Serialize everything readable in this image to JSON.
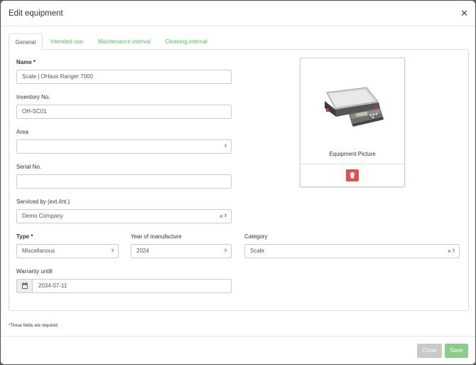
{
  "modal": {
    "title": "Edit equipment",
    "close_icon": "close-icon"
  },
  "tabs": [
    {
      "label": "General",
      "active": true
    },
    {
      "label": "Intended use",
      "active": false
    },
    {
      "label": "Maintenance interval",
      "active": false
    },
    {
      "label": "Cleaning interval",
      "active": false
    }
  ],
  "form": {
    "name": {
      "label": "Name",
      "required_mark": "*",
      "value": "Scale | OHaus Ranger 7000"
    },
    "inventory_no": {
      "label": "Inventory No.",
      "value": "OH-SC01"
    },
    "area": {
      "label": "Area",
      "value": ""
    },
    "serial_no": {
      "label": "Serial No.",
      "value": ""
    },
    "serviced_by": {
      "label": "Serviced by (ext./int.)",
      "value": "Demo Company",
      "clear": "×"
    },
    "type": {
      "label": "Type",
      "required_mark": "*",
      "value": "Miscellanous"
    },
    "year": {
      "label": "Year of manufacture",
      "value": "2024"
    },
    "category": {
      "label": "Category",
      "value": "Scale",
      "clear": "×"
    },
    "warranty": {
      "label": "Warranty untill",
      "value": "2034-07-11"
    }
  },
  "picture": {
    "caption": "Equipment Picture",
    "delete_icon": "trash-icon"
  },
  "required_note": "*These fields are required.",
  "footer": {
    "close_label": "Close",
    "save_label": "Save"
  },
  "colors": {
    "accent": "#5cb85c",
    "danger": "#d9534f",
    "close_btn": "#c9c9c9",
    "save_btn": "#8ccb8c"
  },
  "select_arrow": "⇕"
}
